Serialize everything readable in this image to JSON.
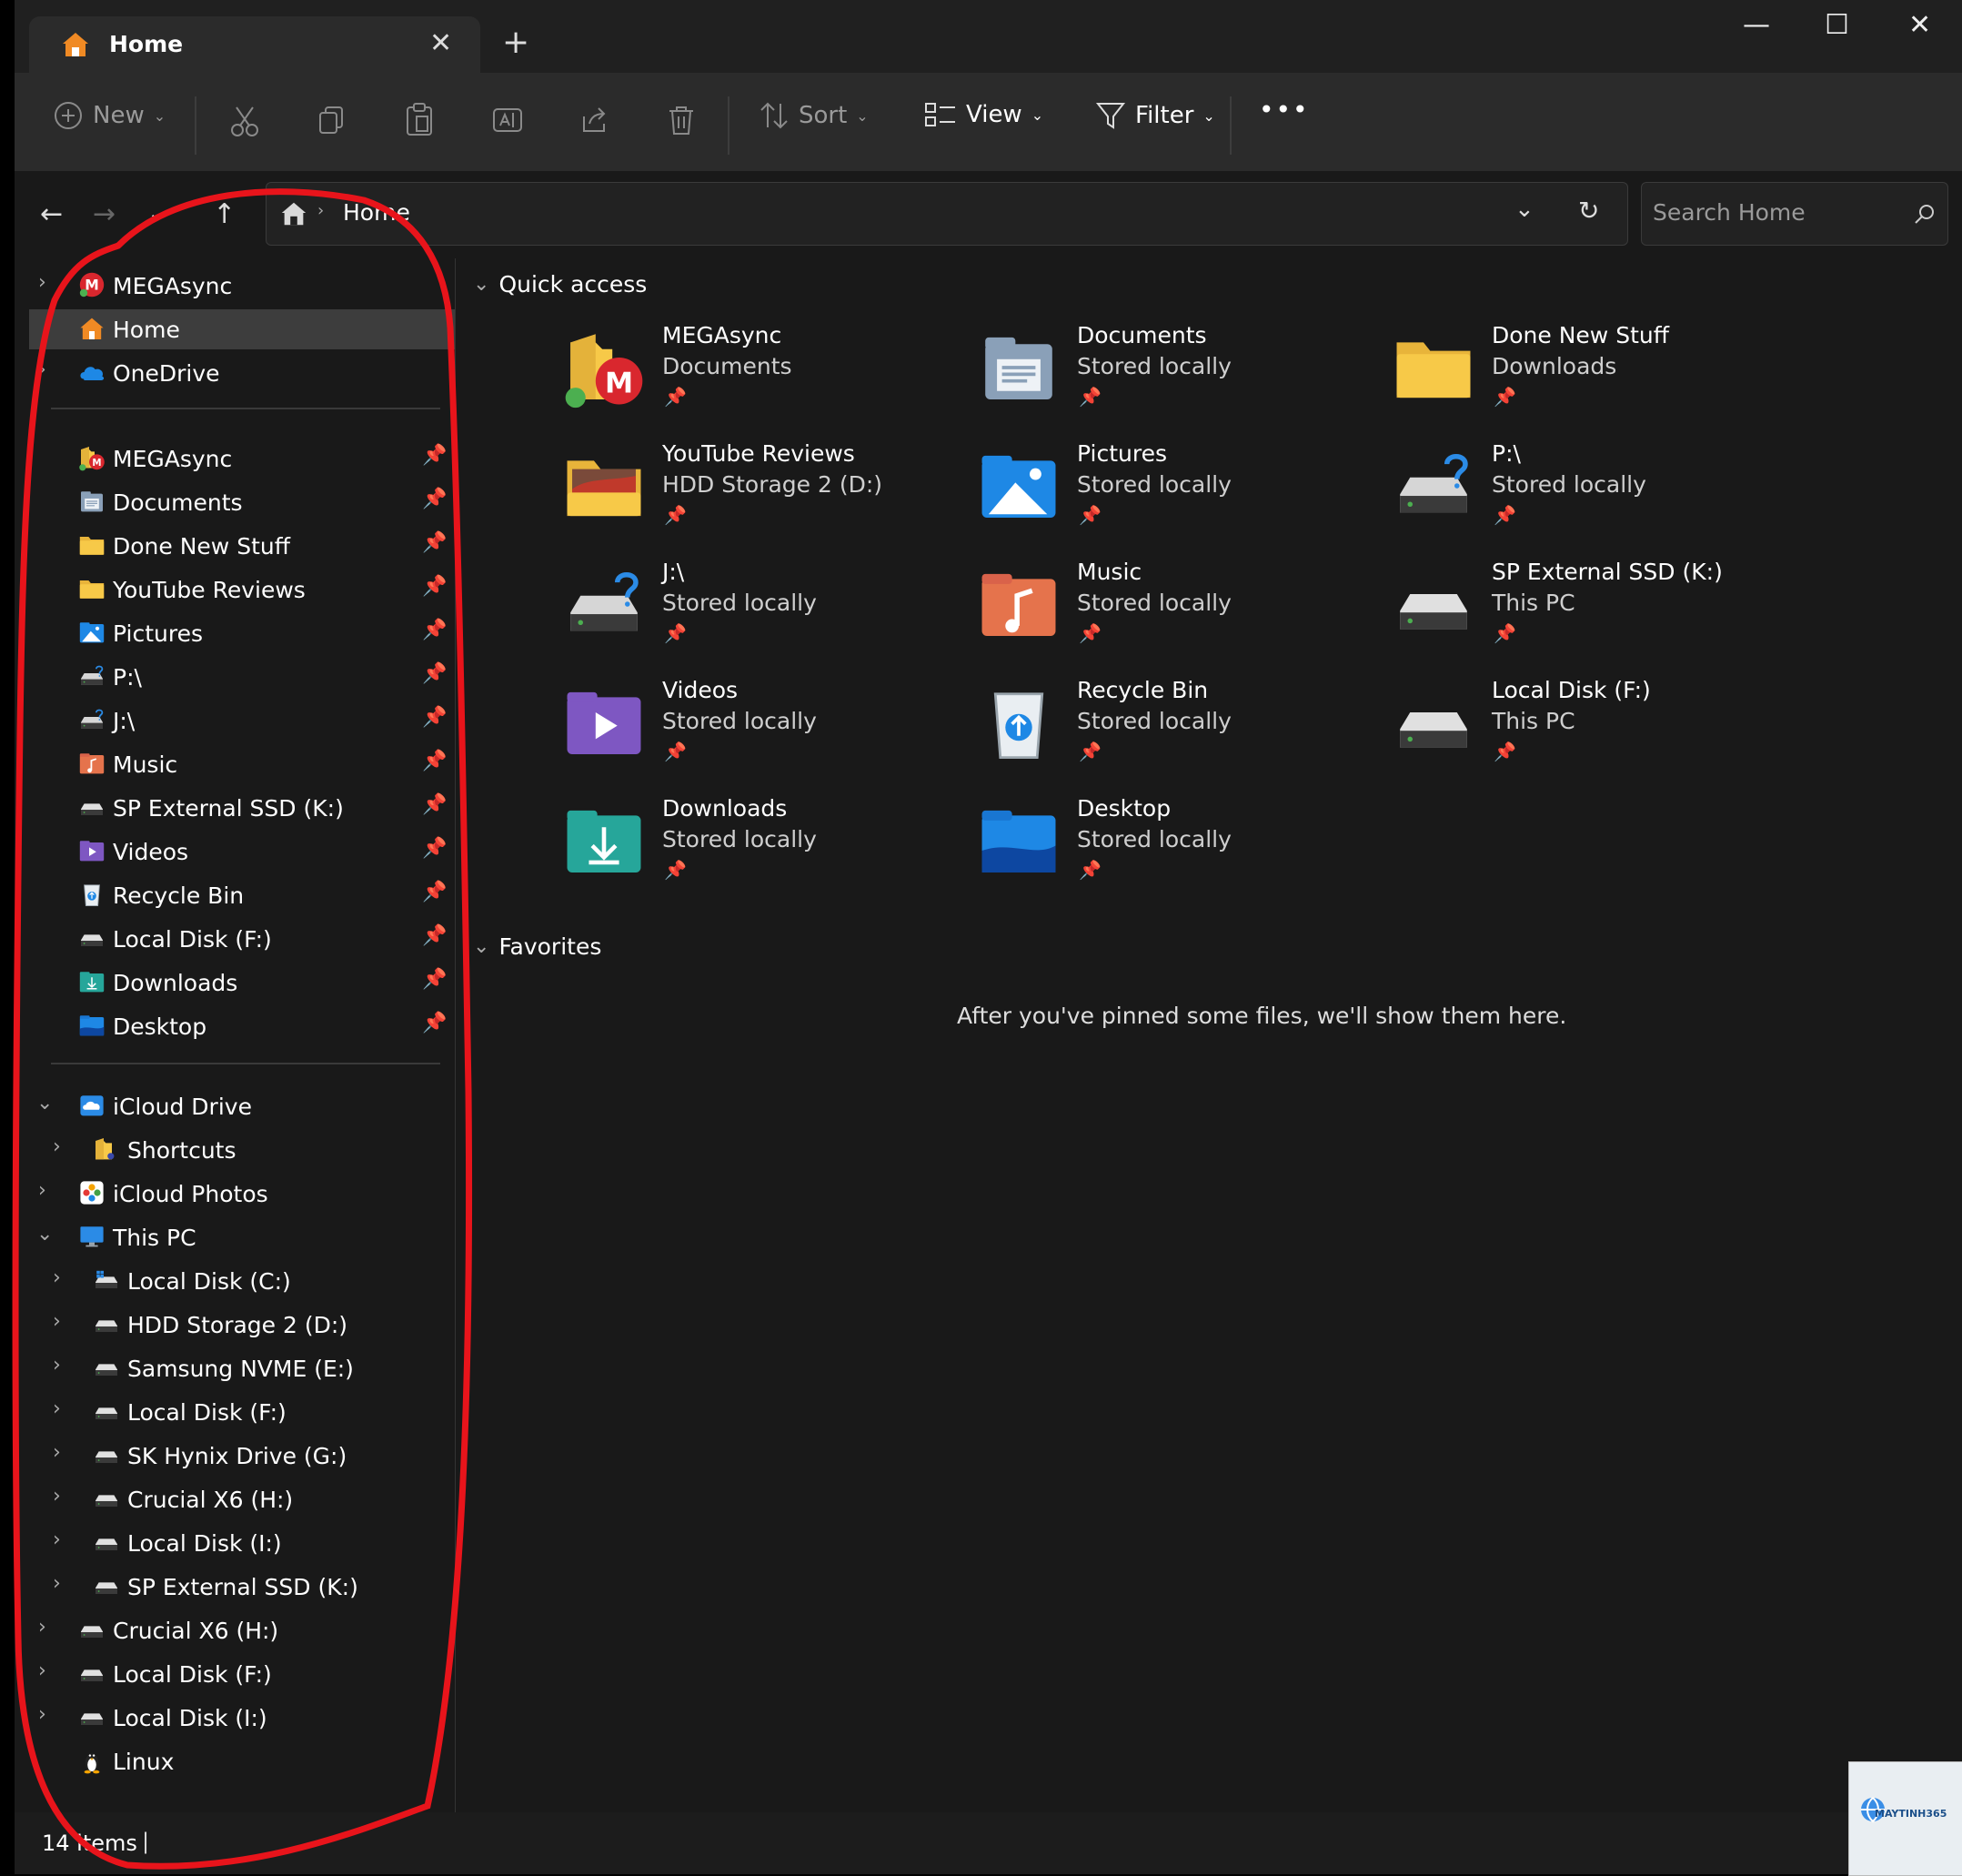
{
  "tab": {
    "title": "Home",
    "close": "✕",
    "new": "+"
  },
  "window_controls": {
    "minimize": "—",
    "maximize": "☐",
    "close": "✕"
  },
  "toolbar": {
    "new_label": "New",
    "sort_label": "Sort",
    "view_label": "View",
    "filter_label": "Filter",
    "more": "•••"
  },
  "address": {
    "path": "Home"
  },
  "search": {
    "placeholder": "Search Home"
  },
  "sidebar": {
    "top": [
      {
        "label": "MEGAsync",
        "icon": "mega-icon",
        "chevron": true
      },
      {
        "label": "Home",
        "icon": "home-icon",
        "selected": true
      },
      {
        "label": "OneDrive",
        "icon": "onedrive-icon",
        "chevron": true
      }
    ],
    "pinned": [
      {
        "label": "MEGAsync",
        "icon": "mega-folder-icon"
      },
      {
        "label": "Documents",
        "icon": "documents-icon"
      },
      {
        "label": "Done New Stuff",
        "icon": "folder-icon"
      },
      {
        "label": "YouTube Reviews",
        "icon": "folder-icon"
      },
      {
        "label": "Pictures",
        "icon": "pictures-icon"
      },
      {
        "label": "P:\\",
        "icon": "network-drive-icon"
      },
      {
        "label": "J:\\",
        "icon": "network-drive-icon"
      },
      {
        "label": "Music",
        "icon": "music-icon"
      },
      {
        "label": "SP External SSD (K:)",
        "icon": "drive-icon"
      },
      {
        "label": "Videos",
        "icon": "videos-icon"
      },
      {
        "label": "Recycle Bin",
        "icon": "recycle-bin-icon"
      },
      {
        "label": "Local Disk (F:)",
        "icon": "drive-icon"
      },
      {
        "label": "Downloads",
        "icon": "downloads-icon"
      },
      {
        "label": "Desktop",
        "icon": "desktop-icon"
      }
    ],
    "tree": [
      {
        "label": "iCloud Drive",
        "icon": "icloud-icon",
        "indent": 0,
        "chevron": "open"
      },
      {
        "label": "Shortcuts",
        "icon": "shortcuts-folder-icon",
        "indent": 1,
        "chevron": "closed"
      },
      {
        "label": "iCloud Photos",
        "icon": "icloud-photos-icon",
        "indent": 0,
        "chevron": "closed"
      },
      {
        "label": "This PC",
        "icon": "this-pc-icon",
        "indent": 0,
        "chevron": "open"
      },
      {
        "label": "Local Disk (C:)",
        "icon": "system-drive-icon",
        "indent": 1,
        "chevron": "closed"
      },
      {
        "label": "HDD Storage 2 (D:)",
        "icon": "drive-icon",
        "indent": 1,
        "chevron": "closed"
      },
      {
        "label": "Samsung NVME (E:)",
        "icon": "drive-icon",
        "indent": 1,
        "chevron": "closed"
      },
      {
        "label": "Local Disk (F:)",
        "icon": "drive-icon",
        "indent": 1,
        "chevron": "closed"
      },
      {
        "label": "SK Hynix Drive (G:)",
        "icon": "drive-icon",
        "indent": 1,
        "chevron": "closed"
      },
      {
        "label": "Crucial X6 (H:)",
        "icon": "drive-icon",
        "indent": 1,
        "chevron": "closed"
      },
      {
        "label": "Local Disk (I:)",
        "icon": "drive-icon",
        "indent": 1,
        "chevron": "closed"
      },
      {
        "label": "SP External SSD (K:)",
        "icon": "drive-icon",
        "indent": 1,
        "chevron": "closed"
      },
      {
        "label": "Crucial X6 (H:)",
        "icon": "drive-icon",
        "indent": 0,
        "chevron": "closed"
      },
      {
        "label": "Local Disk (F:)",
        "icon": "drive-icon",
        "indent": 0,
        "chevron": "closed"
      },
      {
        "label": "Local Disk (I:)",
        "icon": "drive-icon",
        "indent": 0,
        "chevron": "closed"
      },
      {
        "label": "Linux",
        "icon": "linux-icon",
        "indent": 0,
        "chevron": "none"
      }
    ]
  },
  "quick_access": {
    "title": "Quick access",
    "items": [
      {
        "name": "MEGAsync",
        "sub": "Documents",
        "icon": "mega-folder-icon"
      },
      {
        "name": "Documents",
        "sub": "Stored locally",
        "icon": "documents-icon"
      },
      {
        "name": "Done New Stuff",
        "sub": "Downloads",
        "icon": "folder-icon"
      },
      {
        "name": "YouTube Reviews",
        "sub": "HDD Storage 2 (D:)",
        "icon": "folder-image-icon"
      },
      {
        "name": "Pictures",
        "sub": "Stored locally",
        "icon": "pictures-icon"
      },
      {
        "name": "P:\\",
        "sub": "Stored locally",
        "icon": "network-drive-icon"
      },
      {
        "name": "J:\\",
        "sub": "Stored locally",
        "icon": "network-drive-icon"
      },
      {
        "name": "Music",
        "sub": "Stored locally",
        "icon": "music-icon"
      },
      {
        "name": "SP External SSD (K:)",
        "sub": "This PC",
        "icon": "drive-icon"
      },
      {
        "name": "Videos",
        "sub": "Stored locally",
        "icon": "videos-icon"
      },
      {
        "name": "Recycle Bin",
        "sub": "Stored locally",
        "icon": "recycle-bin-icon"
      },
      {
        "name": "Local Disk (F:)",
        "sub": "This PC",
        "icon": "drive-icon"
      },
      {
        "name": "Downloads",
        "sub": "Stored locally",
        "icon": "downloads-icon"
      },
      {
        "name": "Desktop",
        "sub": "Stored locally",
        "icon": "desktop-icon"
      }
    ]
  },
  "favorites": {
    "title": "Favorites",
    "empty_text": "After you've pinned some files, we'll show them here."
  },
  "status": {
    "items": "14 items"
  },
  "watermark": {
    "text": "MAYTINH365"
  },
  "colors": {
    "annotation": "#e8141b",
    "folder": "#f7c948",
    "accent": "#3a8ee6"
  }
}
